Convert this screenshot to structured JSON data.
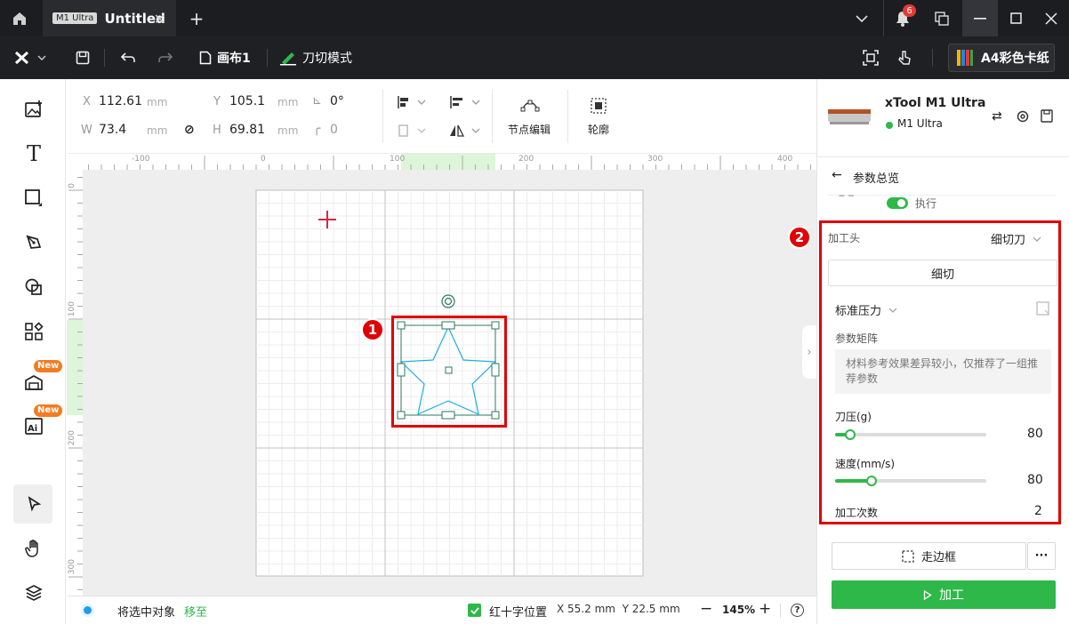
{
  "titlebar": {
    "tab_badge": "M1 Ultra",
    "tab_title": "Untitled",
    "notification_count": "6"
  },
  "menubar": {
    "canvas_name": "画布1",
    "mode_label": "刀切模式",
    "material_label": "A4彩色卡纸"
  },
  "props": {
    "x_label": "X",
    "x_value": "112.61",
    "x_unit": "mm",
    "y_label": "Y",
    "y_value": "105.1",
    "y_unit": "mm",
    "w_label": "W",
    "w_value": "73.4",
    "w_unit": "mm",
    "h_label": "H",
    "h_value": "69.81",
    "h_unit": "mm",
    "rotate_value": "0°",
    "corner_value": "0",
    "node_edit_label": "节点编辑",
    "outline_label": "轮廓"
  },
  "ruler": {
    "h_ticks": [
      "-100",
      "0",
      "100",
      "200",
      "300",
      "400"
    ],
    "v_ticks": [
      "0",
      "100",
      "200",
      "300"
    ]
  },
  "leftbar": {
    "new_badge_1": "New",
    "new_badge_2": "New"
  },
  "status": {
    "move_label": "将选中对象",
    "move_link": "移至",
    "crosshair_label": "红十字位置",
    "coords": "X 55.2 mm  Y 22.5 mm",
    "zoom": "145%"
  },
  "device": {
    "name": "xTool M1 Ultra",
    "model": "M1 Ultra",
    "status_color": "#2fb84a"
  },
  "panel": {
    "back_title": "参数总览",
    "execute_label": "执行",
    "head_label": "加工头",
    "head_value": "细切刀",
    "cut_button": "细切",
    "pressure_preset": "标准压力",
    "matrix_label": "参数矩阵",
    "matrix_note": "材料参考效果差异较小，仅推荐了一组推荐参数",
    "pressure_label": "刀压(g)",
    "pressure_value": "80",
    "pressure_fraction": 0.1,
    "speed_label": "速度(mm/s)",
    "speed_value": "80",
    "speed_fraction": 0.24,
    "passes_label": "加工次数",
    "passes_value": "2",
    "frame_button": "走边框",
    "process_button": "加工"
  },
  "callouts": {
    "one": "1",
    "two": "2"
  },
  "colors": {
    "accent_green": "#2fb84a",
    "callout_red": "#e00000",
    "shape_cyan": "#1ab0dc"
  }
}
